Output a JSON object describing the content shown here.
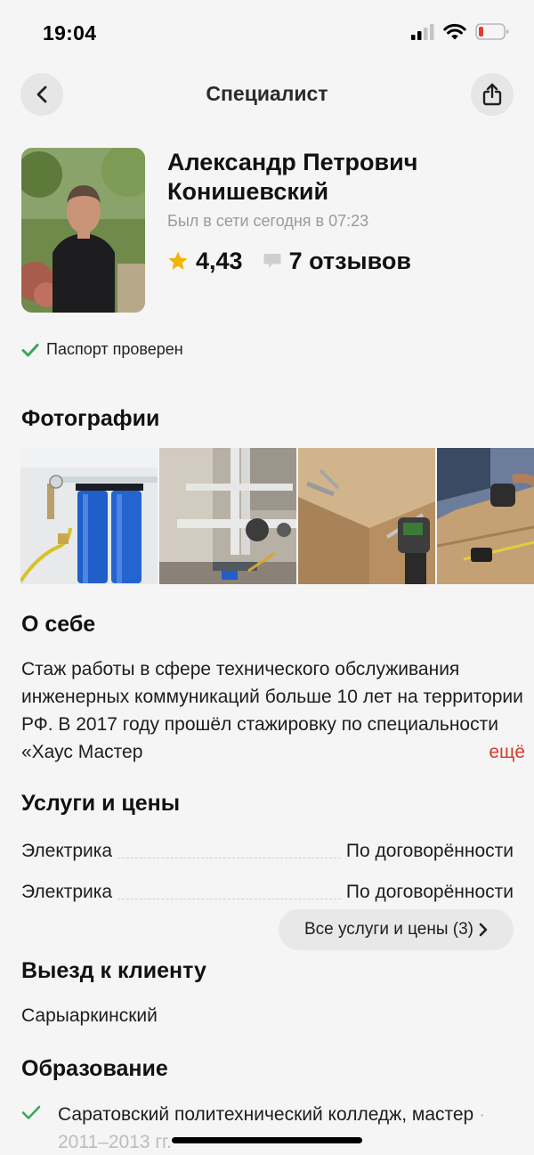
{
  "status": {
    "time": "19:04"
  },
  "nav": {
    "title": "Специалист",
    "back_icon": "chevron-left-icon",
    "share_icon": "share-icon"
  },
  "profile": {
    "name": "Александр Петрович Конишевский",
    "online": "Был в сети сегодня в 07:23",
    "rating": "4,43",
    "reviews": "7 отзывов"
  },
  "passport": "Паспорт проверен",
  "photos": {
    "title": "Фотографии",
    "count_visible": 4
  },
  "about": {
    "title": "О себе",
    "text": "Стаж работы в сфере технического обслуживания инженерных коммуникаций больше 10 лет на территории РФ. В 2017 году прошёл стажировку по специальности «Хаус Мастер",
    "more": "ещё"
  },
  "services": {
    "title": "Услуги и цены",
    "items": [
      {
        "name": "Электрика",
        "price": "По договорённости"
      },
      {
        "name": "Электрика",
        "price": "По договорённости"
      }
    ],
    "all_button": "Все услуги и цены (3)"
  },
  "visit": {
    "title": "Выезд к клиенту",
    "area": "Сарыаркинский"
  },
  "education": {
    "title": "Образование",
    "item_text": "Саратовский политехнический колледж, мастер",
    "item_years": "2011–2013 гг."
  },
  "colors": {
    "accent_red": "#d63a2f",
    "check_green": "#3aa757",
    "star": "#f2b400",
    "background": "#f5f5f5"
  }
}
